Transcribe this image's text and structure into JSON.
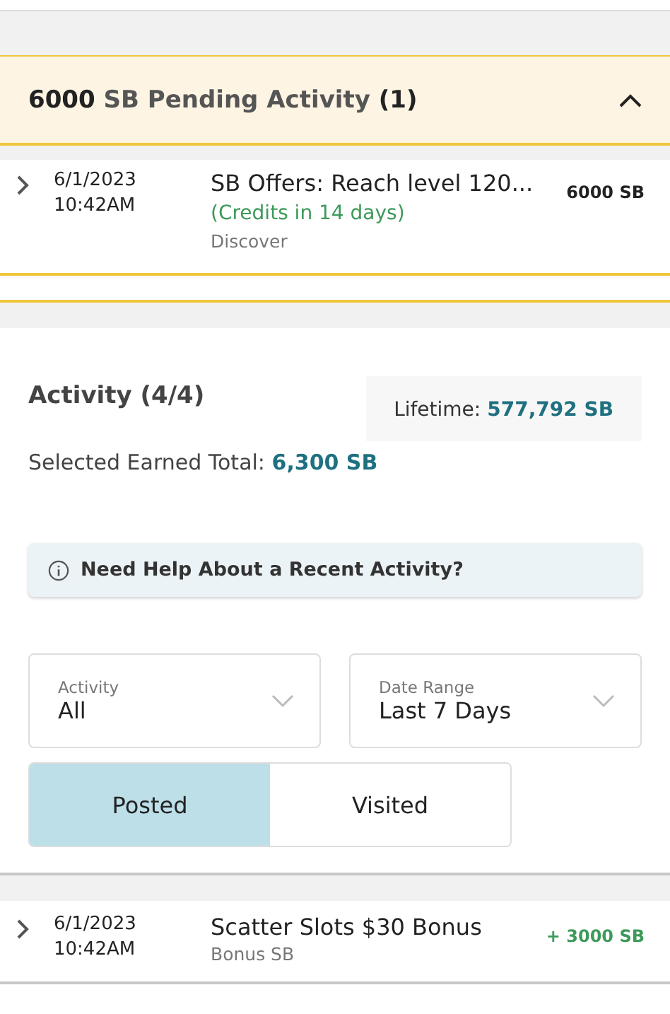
{
  "pending": {
    "amount": "6000",
    "label": "SB Pending Activity",
    "count": "(1)",
    "expanded": true,
    "rows": [
      {
        "date": "6/1/2023",
        "time": "10:42AM",
        "title": "SB Offers: Reach level 120...",
        "note": "(Credits in 14 days)",
        "category": "Discover",
        "amount": "6000 SB",
        "kind": "pending"
      }
    ]
  },
  "activity": {
    "title": "Activity (4/4)",
    "lifetime_label": "Lifetime:",
    "lifetime_value": "577,792 SB",
    "total_label": "Selected Earned Total:",
    "total_value": "6,300 SB"
  },
  "help": {
    "text": "Need Help About a Recent Activity?"
  },
  "filters": [
    {
      "label": "Activity",
      "value": "All"
    },
    {
      "label": "Date Range",
      "value": "Last 7 Days"
    }
  ],
  "tabs": [
    {
      "label": "Posted",
      "selected": true
    },
    {
      "label": "Visited",
      "selected": false
    }
  ],
  "transactions": [
    {
      "date": "6/1/2023",
      "time": "10:42AM",
      "title": "Scatter Slots $30 Bonus",
      "category": "Bonus SB",
      "amount": "+ 3000 SB",
      "kind": "credit"
    }
  ]
}
